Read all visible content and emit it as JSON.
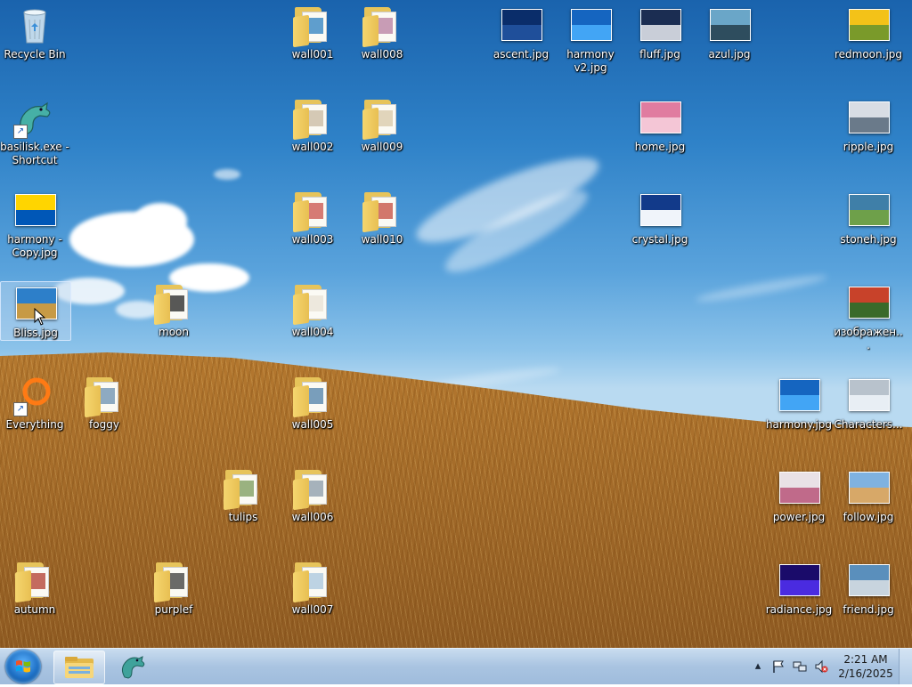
{
  "desktop": {
    "icons": [
      {
        "label": "Recycle Bin",
        "kind": "recycle",
        "row": 0,
        "col": 0
      },
      {
        "label": "basilisk.exe - Shortcut",
        "kind": "app-basilisk",
        "row": 1,
        "col": 0
      },
      {
        "label": "harmony - Copy.jpg",
        "kind": "thumb",
        "colors": [
          "#ffd500",
          "#0057b7"
        ],
        "row": 2,
        "col": 0
      },
      {
        "label": "Bliss.jpg",
        "kind": "thumb",
        "colors": [
          "#2d7fc9",
          "#c79a45"
        ],
        "row": 3,
        "col": 0,
        "selected": true
      },
      {
        "label": "Everything",
        "kind": "app-everything",
        "row": 4,
        "col": 0
      },
      {
        "label": "autumn",
        "kind": "folder",
        "accent": "#b13b2e",
        "row": 6,
        "col": 0
      },
      {
        "label": "foggy",
        "kind": "folder",
        "accent": "#6a8fb0",
        "row": 4,
        "col": 1
      },
      {
        "label": "moon",
        "kind": "folder",
        "accent": "#222222",
        "row": 3,
        "col": 2
      },
      {
        "label": "purplef",
        "kind": "folder",
        "accent": "#3a3a3a",
        "row": 6,
        "col": 2
      },
      {
        "label": "tulips",
        "kind": "folder",
        "accent": "#7a9a5a",
        "row": 5,
        "col": 3
      },
      {
        "label": "wall001",
        "kind": "folder",
        "accent": "#2b7fc0",
        "row": 0,
        "col": 4
      },
      {
        "label": "wall002",
        "kind": "folder",
        "accent": "#c8b8a0",
        "row": 1,
        "col": 4
      },
      {
        "label": "wall003",
        "kind": "folder",
        "accent": "#c9504a",
        "row": 2,
        "col": 4
      },
      {
        "label": "wall004",
        "kind": "folder",
        "accent": "#e8e2d6",
        "row": 3,
        "col": 4
      },
      {
        "label": "wall005",
        "kind": "folder",
        "accent": "#4d7fa8",
        "row": 4,
        "col": 4
      },
      {
        "label": "wall006",
        "kind": "folder",
        "accent": "#8a9aa8",
        "row": 5,
        "col": 4
      },
      {
        "label": "wall007",
        "kind": "folder",
        "accent": "#a8c6de",
        "row": 6,
        "col": 4
      },
      {
        "label": "wall008",
        "kind": "folder",
        "accent": "#b77ca0",
        "row": 0,
        "col": 5
      },
      {
        "label": "wall009",
        "kind": "folder",
        "accent": "#d8c8a8",
        "row": 1,
        "col": 5
      },
      {
        "label": "wall010",
        "kind": "folder",
        "accent": "#c44b3e",
        "row": 2,
        "col": 5
      },
      {
        "label": "ascent.jpg",
        "kind": "thumb",
        "colors": [
          "#0a2d6a",
          "#1f4f9a"
        ],
        "row": 0,
        "col": 7
      },
      {
        "label": "harmony v2.jpg",
        "kind": "thumb",
        "colors": [
          "#1565c0",
          "#42a5f5"
        ],
        "row": 0,
        "col": 8
      },
      {
        "label": "fluff.jpg",
        "kind": "thumb",
        "colors": [
          "#1b2d52",
          "#c9ced8"
        ],
        "row": 0,
        "col": 9
      },
      {
        "label": "home.jpg",
        "kind": "thumb",
        "colors": [
          "#e07ca0",
          "#f4c6d6"
        ],
        "row": 1,
        "col": 9
      },
      {
        "label": "crystal.jpg",
        "kind": "thumb",
        "colors": [
          "#123a8a",
          "#f0f4fa"
        ],
        "row": 2,
        "col": 9
      },
      {
        "label": "azul.jpg",
        "kind": "thumb",
        "colors": [
          "#6aa6c8",
          "#2e4d5e"
        ],
        "row": 0,
        "col": 10
      },
      {
        "label": "harmony.jpg",
        "kind": "thumb",
        "colors": [
          "#1565c0",
          "#42a5f5"
        ],
        "row": 4,
        "col": 11
      },
      {
        "label": "power.jpg",
        "kind": "thumb",
        "colors": [
          "#e9e1e6",
          "#c06a8a"
        ],
        "row": 5,
        "col": 11
      },
      {
        "label": "radiance.jpg",
        "kind": "thumb",
        "colors": [
          "#1a0b6a",
          "#4a2be0"
        ],
        "row": 6,
        "col": 11
      },
      {
        "label": "redmoon.jpg",
        "kind": "thumb",
        "colors": [
          "#f3c218",
          "#7a9a2a"
        ],
        "row": 0,
        "col": 12
      },
      {
        "label": "ripple.jpg",
        "kind": "thumb",
        "colors": [
          "#d8dde4",
          "#6a7a8a"
        ],
        "row": 1,
        "col": 12
      },
      {
        "label": "stoneh.jpg",
        "kind": "thumb",
        "colors": [
          "#3f7fa8",
          "#6ea04a"
        ],
        "row": 2,
        "col": 12
      },
      {
        "label": "изображен...",
        "kind": "thumb",
        "colors": [
          "#c8422a",
          "#3a6a2a"
        ],
        "row": 3,
        "col": 12
      },
      {
        "label": "Characters...",
        "kind": "thumb",
        "colors": [
          "#b8c2cc",
          "#e8eef4"
        ],
        "row": 4,
        "col": 12
      },
      {
        "label": "follow.jpg",
        "kind": "thumb",
        "colors": [
          "#7fb2e0",
          "#d7a868"
        ],
        "row": 5,
        "col": 12
      },
      {
        "label": "friend.jpg",
        "kind": "thumb",
        "colors": [
          "#5a8fbc",
          "#c8d4de"
        ],
        "row": 6,
        "col": 12
      }
    ]
  },
  "taskbar": {
    "start_label": "Start",
    "pinned": [
      {
        "name": "file-explorer",
        "title": "Windows Explorer"
      },
      {
        "name": "basilisk",
        "title": "Basilisk"
      }
    ],
    "tray_icons": [
      "show-hidden-icons",
      "action-center-flag",
      "network-icon",
      "volume-muted-icon"
    ],
    "clock_time": "2:21 AM",
    "clock_date": "2/16/2025"
  }
}
